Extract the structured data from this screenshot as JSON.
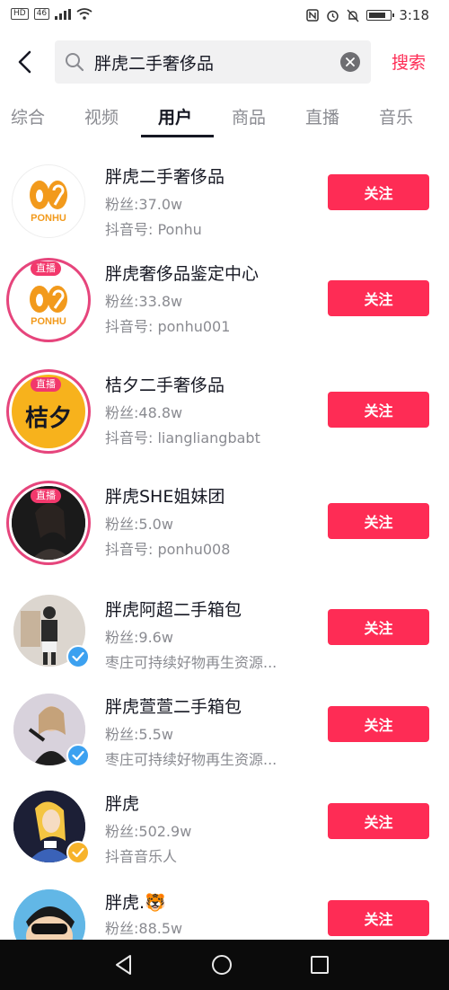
{
  "status_bar": {
    "hd_badge": "HD",
    "net_badge": "46",
    "time": "3:18"
  },
  "search": {
    "query": "胖虎二手奢侈品",
    "button_label": "搜索"
  },
  "tabs": [
    {
      "label": "综合",
      "active": false
    },
    {
      "label": "视频",
      "active": false
    },
    {
      "label": "用户",
      "active": true
    },
    {
      "label": "商品",
      "active": false
    },
    {
      "label": "直播",
      "active": false
    },
    {
      "label": "音乐",
      "active": false
    }
  ],
  "users": [
    {
      "name": "胖虎二手奢侈品",
      "fans": "粉丝:37.0w",
      "extra": "抖音号: Ponhu",
      "follow": "关注",
      "avatar_logo": "PONHU",
      "live": false
    },
    {
      "name": "胖虎奢侈品鉴定中心",
      "fans": "粉丝:33.8w",
      "extra": "抖音号: ponhu001",
      "follow": "关注",
      "avatar_logo": "PONHU",
      "live": true,
      "live_label": "直播"
    },
    {
      "name": "桔夕二手奢侈品",
      "fans": "粉丝:48.8w",
      "extra": "抖音号: liangliangbabt",
      "follow": "关注",
      "avatar_logo": "桔夕",
      "live": true,
      "live_label": "直播"
    },
    {
      "name": "胖虎SHE姐妹团",
      "fans": "粉丝:5.0w",
      "extra": "抖音号: ponhu008",
      "follow": "关注",
      "live": true,
      "live_label": "直播"
    },
    {
      "name": "胖虎阿超二手箱包",
      "fans": "粉丝:9.6w",
      "extra": "枣庄可持续好物再生资源...",
      "follow": "关注",
      "verified": "blue"
    },
    {
      "name": "胖虎萱萱二手箱包",
      "fans": "粉丝:5.5w",
      "extra": "枣庄可持续好物再生资源...",
      "follow": "关注",
      "verified": "blue"
    },
    {
      "name": "胖虎",
      "fans": "粉丝:502.9w",
      "extra": "抖音音乐人",
      "follow": "关注",
      "verified": "yellow"
    },
    {
      "name": "胖虎.🐯",
      "fans": "粉丝:88.5w",
      "extra": "",
      "follow": "关注"
    }
  ],
  "colors": {
    "accent": "#fe2c55",
    "live": "#e6457c",
    "verify_blue": "#3ca1f0",
    "verify_yellow": "#f7b32b"
  }
}
